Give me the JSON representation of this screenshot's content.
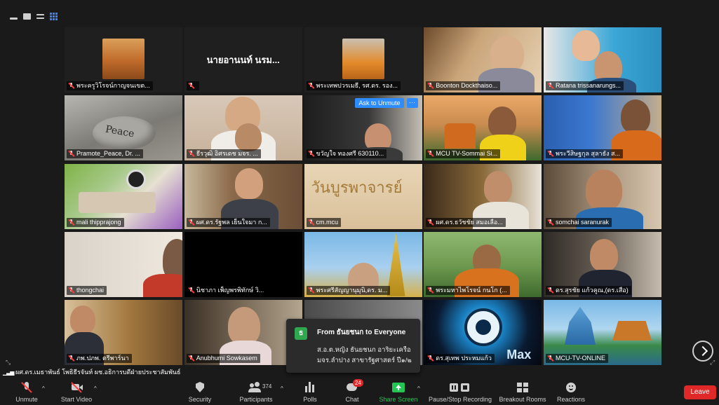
{
  "meeting": {
    "tiles": [
      {
        "label": "พระครูวิโรจน์กาญจนเขต...",
        "kind": "avatar"
      },
      {
        "label": "",
        "kind": "namecard",
        "namecard": "นายอานนท์ นรม..."
      },
      {
        "label": "พระเทพปวรเมธี, รศ.ดร. รอง...",
        "kind": "avatar"
      },
      {
        "label": "Boonton Dockthaiso...",
        "kind": "video"
      },
      {
        "label": "Ratana trissanarungs...",
        "kind": "video"
      },
      {
        "label": "Pramote_Peace, Dr. ...",
        "kind": "video",
        "overlay_text": "Peace"
      },
      {
        "label": "ธีรวุฒิ อิศรเดช มจร. ...",
        "kind": "video"
      },
      {
        "label": "ขวัญใจ ทองศรี 630110...",
        "kind": "video",
        "ask_to_unmute": "Ask to Unmute",
        "more": "···"
      },
      {
        "label": "MCU TV-Sommai Si...",
        "kind": "video"
      },
      {
        "label": "พระวีสิษฐกุล สุลาธัง ส...",
        "kind": "video"
      },
      {
        "label": "mali thipprajong",
        "kind": "video"
      },
      {
        "label": "ผศ.ดร.รัฐพล เย็นใจมา ก...",
        "kind": "video"
      },
      {
        "label": "cm.mcu",
        "kind": "video",
        "overlay_text": "วันบูรพาจารย์"
      },
      {
        "label": "ผศ.ดร.ธวัชชัย สมอเลือ...",
        "kind": "video"
      },
      {
        "label": "somchai saranurak",
        "kind": "video"
      },
      {
        "label": "thongchai",
        "kind": "video"
      },
      {
        "label": "นิชาภา เพ็ญพรพิทักษ์ วิ...",
        "kind": "black"
      },
      {
        "label": "พระศรีสัญญานุมุนิ,ดร. ม...",
        "kind": "video"
      },
      {
        "label": "พระมหาไพโรจน์ กนโก (...",
        "kind": "video"
      },
      {
        "label": "ดร.สุรชัย แก้วคูณ,(ดร.เสือ)",
        "kind": "video"
      },
      {
        "label": "ภพ.ปภพ. ตรีพาร์นา",
        "kind": "video"
      },
      {
        "label": "Anubhumi Sowkasem",
        "kind": "video"
      },
      {
        "label": "",
        "kind": "video"
      },
      {
        "label": "ดร.สุเทพ ประหมแก้ว",
        "kind": "video",
        "overlay_text": "Max"
      },
      {
        "label": "MCU-TV-ONLINE",
        "kind": "video"
      }
    ],
    "chat_popup": {
      "avatar_letter": "ธ",
      "from": "From ธันยชนก to Everyone",
      "message": "ส.อ.ต.หญิง ธันยชนก อาริยะเครือ มจร.ลำปาง สาขารัฐศาสตร์ ปี๑/๒"
    },
    "speaking": "ผศ.ดร.เมธาพันธ์ โพธิธีรจันท์ ผช.อธิการบดีฝ่ายประชาสัมพันธ์"
  },
  "toolbar": {
    "unmute": "Unmute",
    "start_video": "Start Video",
    "security": "Security",
    "participants": "Participants",
    "participants_count": "374",
    "polls": "Polls",
    "chat": "Chat",
    "chat_badge": "24",
    "share_screen": "Share Screen",
    "record": "Pause/Stop Recording",
    "breakout": "Breakout Rooms",
    "reactions": "Reactions",
    "leave": "Leave"
  },
  "colors": {
    "accent_blue": "#2d8cff",
    "share_green": "#23c553",
    "leave_red": "#e02828",
    "bg": "#1a1a1a"
  }
}
